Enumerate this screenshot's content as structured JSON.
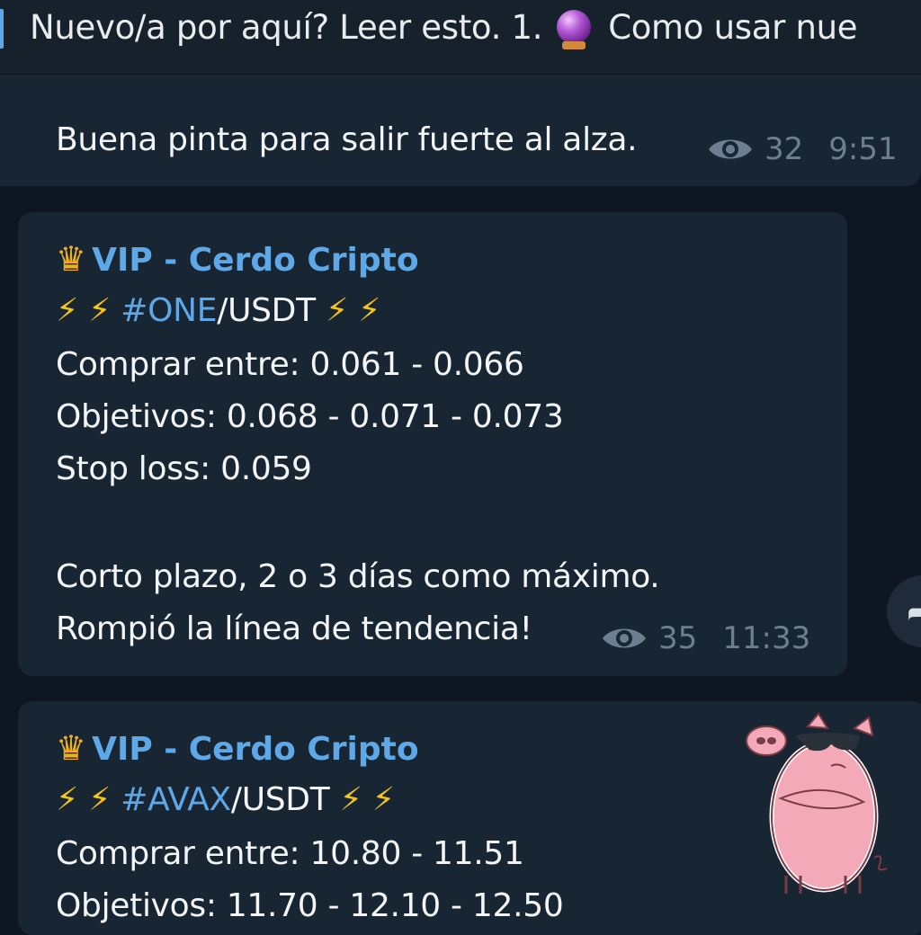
{
  "pinned": {
    "text_before": "Nuevo/a por aquí? Leer esto.  1.",
    "text_after": "Como usar nue",
    "icon": "crystal-ball-icon"
  },
  "messages": [
    {
      "lines": [
        "Buena pinta para salir fuerte al alza."
      ],
      "views": "32",
      "time": "9:51"
    },
    {
      "sender": "VIP - Cerdo Cripto",
      "sender_icon": "crown-icon",
      "bolts": "⚡ ⚡",
      "hashtag": "#ONE",
      "pair_suffix": "/USDT",
      "lines": [
        "Comprar entre: 0.061 - 0.066",
        "Objetivos: 0.068 - 0.071 - 0.073",
        "Stop loss: 0.059",
        "",
        "Corto plazo, 2 o 3 días como máximo.",
        "Rompió la línea de tendencia!"
      ],
      "views": "35",
      "time": "11:33"
    },
    {
      "sender": "VIP - Cerdo Cripto",
      "sender_icon": "crown-icon",
      "bolts": "⚡ ⚡",
      "hashtag": "#AVAX",
      "pair_suffix": "/USDT",
      "lines": [
        "Comprar entre: 10.80 - 11.51",
        "Objetivos: 11.70 - 12.10 - 12.50"
      ]
    }
  ],
  "colors": {
    "background": "#0e1621",
    "bubble": "#182533",
    "accent": "#5fa8e8",
    "meta": "#6d7f8f",
    "bolt": "#f7c517"
  },
  "sticker": "cool-pig-sticker",
  "share_icon": "share-arrow-icon"
}
